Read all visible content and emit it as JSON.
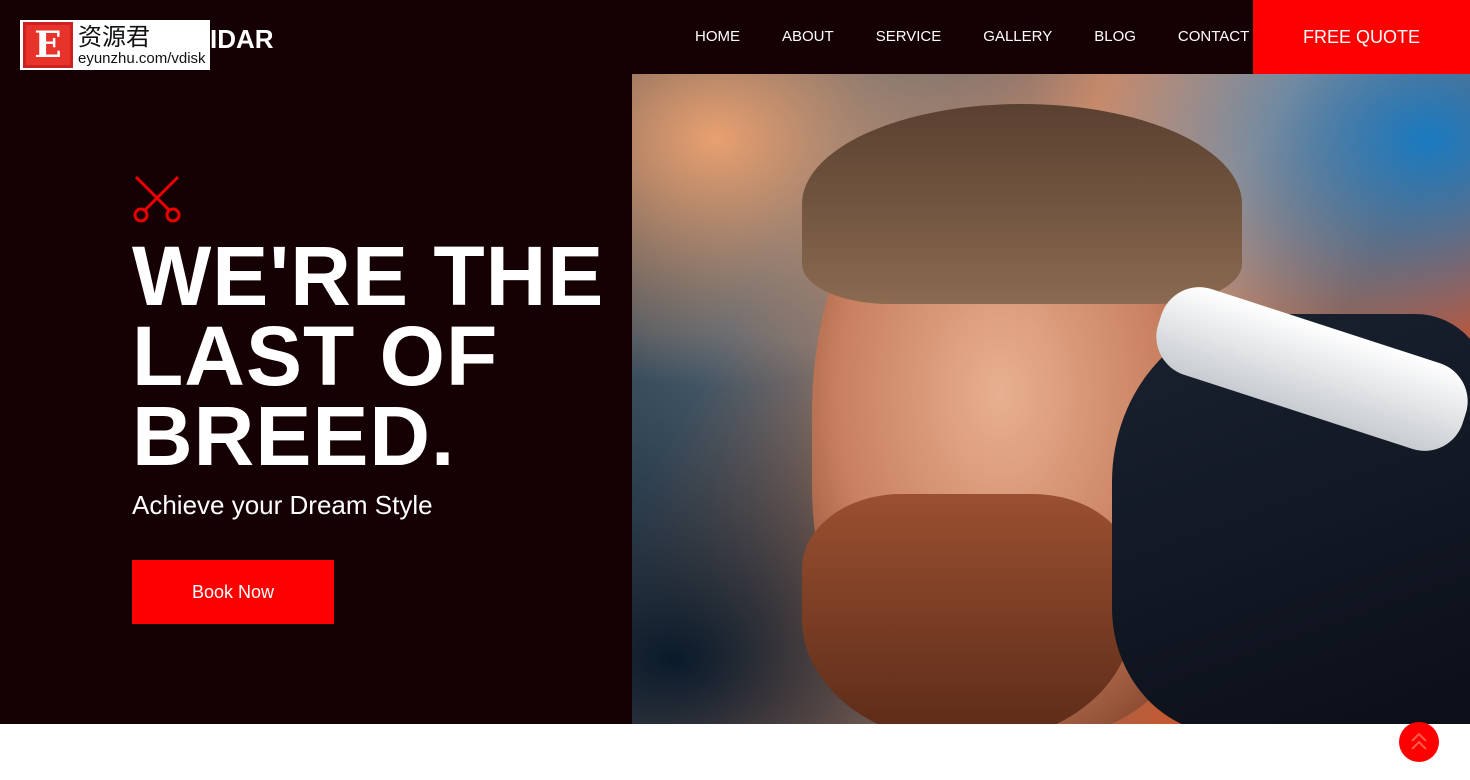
{
  "header": {
    "logo_watermark": {
      "mark": "E",
      "cn": "资源君",
      "url": "eyunzhu.com/vdisk"
    },
    "brand_visible": "IDAR",
    "nav": [
      {
        "label": "HOME"
      },
      {
        "label": "ABOUT"
      },
      {
        "label": "SERVICE"
      },
      {
        "label": "GALLERY"
      },
      {
        "label": "BLOG"
      },
      {
        "label": "CONTACT"
      }
    ],
    "cta": "FREE QUOTE"
  },
  "hero": {
    "icon": "scissors-icon",
    "title_lines": [
      "WE'RE THE",
      "LAST OF",
      "BREED."
    ],
    "subtitle": "Achieve your Dream Style",
    "button": "Book Now"
  },
  "colors": {
    "accent": "#ff0000",
    "background": "#150003"
  },
  "back_to_top_icon": "chevron-up-icon"
}
